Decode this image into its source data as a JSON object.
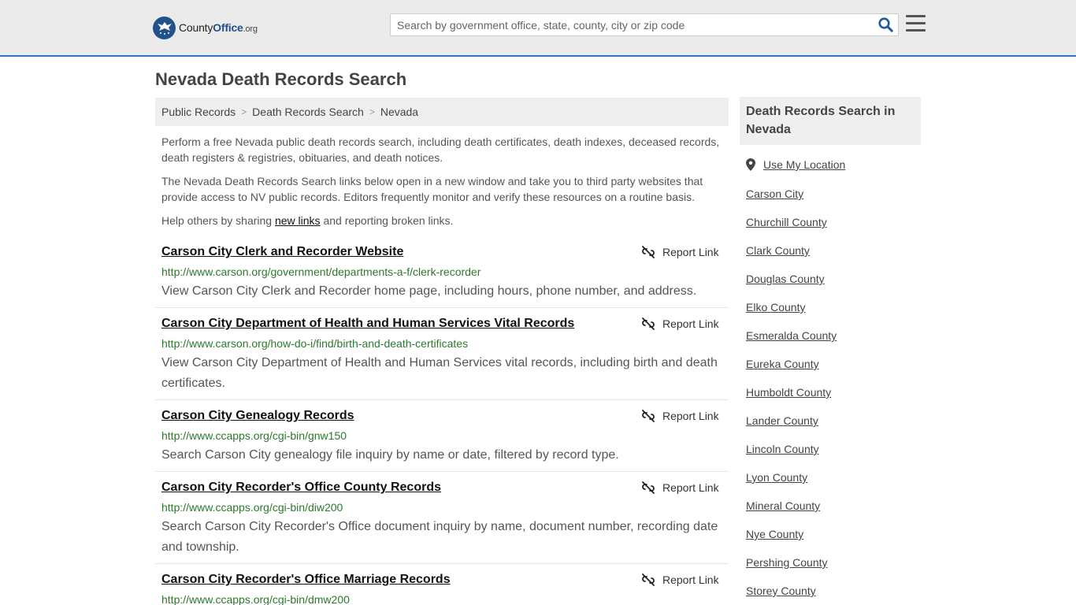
{
  "header": {
    "logo_part1": "County",
    "logo_part2": "Office",
    "logo_part3": ".org",
    "search_placeholder": "Search by government office, state, county, city or zip code",
    "icons": {
      "search": "search-icon",
      "menu": "hamburger-menu-icon",
      "logo": "eagle-logo-icon"
    },
    "accent_color": "#3473b7"
  },
  "page_title": "Nevada Death Records Search",
  "breadcrumb": [
    "Public Records",
    "Death Records Search",
    "Nevada"
  ],
  "intro": {
    "p1": "Perform a free Nevada public death records search, including death certificates, death indexes, deceased records, death registers & registries, obituaries, and death notices.",
    "p2": "The Nevada Death Records Search links below open in a new window and take you to third party websites that provide access to NV public records. Editors frequently monitor and verify these resources on a routine basis.",
    "p3_before": "Help others by sharing ",
    "p3_link": "new links",
    "p3_after": " and reporting broken links."
  },
  "report_label": "Report Link",
  "results": [
    {
      "title": "Carson City Clerk and Recorder Website",
      "url": "http://www.carson.org/government/departments-a-f/clerk-recorder",
      "desc": "View Carson City Clerk and Recorder home page, including hours, phone number, and address."
    },
    {
      "title": "Carson City Department of Health and Human Services Vital Records",
      "url": "http://www.carson.org/how-do-i/find/birth-and-death-certificates",
      "desc": "View Carson City Department of Health and Human Services vital records, including birth and death certificates."
    },
    {
      "title": "Carson City Genealogy Records",
      "url": "http://www.ccapps.org/cgi-bin/gnw150",
      "desc": "Search Carson City genealogy file inquiry by name or date, filtered by record type."
    },
    {
      "title": "Carson City Recorder's Office County Records",
      "url": "http://www.ccapps.org/cgi-bin/diw200",
      "desc": "Search Carson City Recorder's Office document inquiry by name, document number, recording date and township."
    },
    {
      "title": "Carson City Recorder's Office Marriage Records",
      "url": "http://www.ccapps.org/cgi-bin/dmw200",
      "desc": ""
    }
  ],
  "sidebar": {
    "heading": "Death Records Search in Nevada",
    "location_label": "Use My Location",
    "items": [
      "Carson City",
      "Churchill County",
      "Clark County",
      "Douglas County",
      "Elko County",
      "Esmeralda County",
      "Eureka County",
      "Humboldt County",
      "Lander County",
      "Lincoln County",
      "Lyon County",
      "Mineral County",
      "Nye County",
      "Pershing County",
      "Storey County"
    ]
  }
}
